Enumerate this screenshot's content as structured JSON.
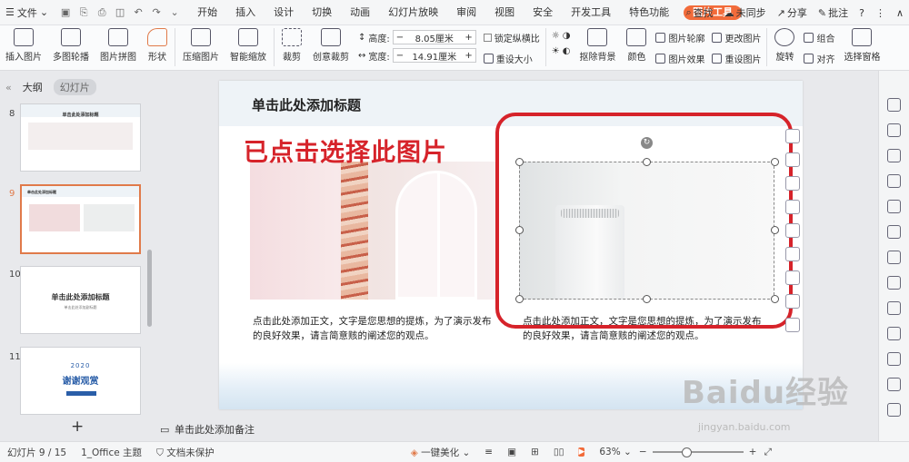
{
  "menubar": {
    "file_label": "文件",
    "tabs": [
      "开始",
      "插入",
      "设计",
      "切换",
      "动画",
      "幻灯片放映",
      "审阅",
      "视图",
      "安全",
      "开发工具",
      "特色功能",
      "图片工具"
    ],
    "active_tab": "图片工具",
    "search_label": "查找",
    "sync_label": "未同步",
    "share_label": "分享",
    "annotate_label": "批注"
  },
  "toolbar": {
    "insert_picture": "插入图片",
    "multi_carousel": "多图轮播",
    "picture_collage": "图片拼图",
    "shape": "形状",
    "compress": "压缩图片",
    "smart_scale": "智能缩放",
    "crop": "裁剪",
    "creative_crop": "创意裁剪",
    "height_label": "高度:",
    "height_value": "8.05厘米",
    "width_label": "宽度:",
    "width_value": "14.91厘米",
    "lock_ratio": "锁定纵横比",
    "reset_size": "重设大小",
    "remove_bg": "抠除背景",
    "color": "颜色",
    "outline": "图片轮廓",
    "effect": "图片效果",
    "change_picture": "更改图片",
    "reset_picture": "重设图片",
    "rotate": "旋转",
    "group": "组合",
    "align": "对齐",
    "select_pane": "选择窗格"
  },
  "left_panel": {
    "tab_outline": "大纲",
    "tab_slides": "幻灯片",
    "slides": [
      {
        "num": "8",
        "title": "单击此处添加标题"
      },
      {
        "num": "9",
        "title": "单击此处添加标题"
      },
      {
        "num": "10",
        "title": "单击此处添加标题",
        "subtitle": "单击此处添加副标题"
      },
      {
        "num": "11",
        "year": "2020",
        "title": "谢谢观赏"
      }
    ]
  },
  "slide": {
    "title": "单击此处添加标题",
    "annotation": "已点击选择此图片",
    "body_left": "点击此处添加正文，文字是您思想的提炼，为了演示发布的良好效果，请言简意赅的阐述您的观点。",
    "body_right": "点击此处添加正文，文字是您思想的提炼，为了演示发布的良好效果，请言简意赅的阐述您的观点。"
  },
  "notes": {
    "placeholder": "单击此处添加备注"
  },
  "status": {
    "slide_indicator": "幻灯片 9 / 15",
    "theme": "1_Office 主题",
    "protection": "文档未保护",
    "beautify": "一键美化",
    "zoom": "63%"
  },
  "watermark": {
    "logo": "Baidu经验",
    "url": "jingyan.baidu.com"
  },
  "colors": {
    "accent": "#f26b3a",
    "annotation_red": "#d6232a"
  }
}
